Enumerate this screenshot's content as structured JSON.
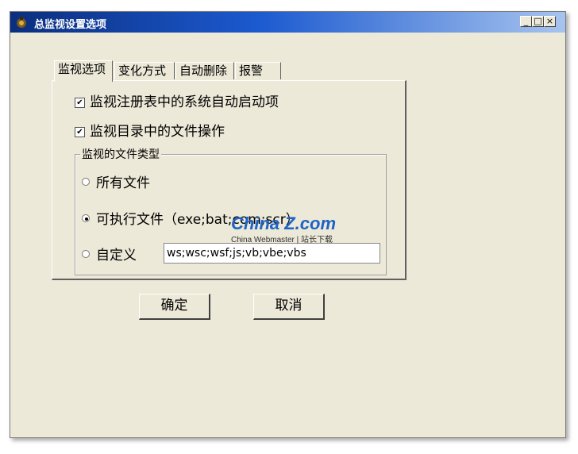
{
  "window": {
    "title": "总监视设置选项",
    "buttons": {
      "minimize": "_",
      "maximize": "□",
      "close": "×"
    }
  },
  "tabs": [
    {
      "label": "监视选项",
      "active": true
    },
    {
      "label": "变化方式",
      "active": false
    },
    {
      "label": "自动删除",
      "active": false
    },
    {
      "label": "报警",
      "active": false
    }
  ],
  "options": {
    "registry": {
      "label": "监视注册表中的系统自动启动项",
      "checked": true
    },
    "directory": {
      "label": "监视目录中的文件操作",
      "checked": true
    }
  },
  "file_types": {
    "group_label": "监视的文件类型",
    "all_files": {
      "label": "所有文件",
      "selected": false
    },
    "executables": {
      "label": "可执行文件（exe;bat;com;scr）",
      "selected": true
    },
    "custom": {
      "label": "自定义",
      "selected": false,
      "value": "ws;wsc;wsf;js;vb;vbe;vbs"
    }
  },
  "actions": {
    "ok_label": "确定",
    "cancel_label": "取消"
  },
  "watermark": {
    "brand": "China Z.com",
    "subtitle": "China Webmaster | 站长下载"
  },
  "colors": {
    "window_bg": "#ece9d8",
    "titlebar_start": "#0b2e7e",
    "titlebar_end": "#a7c4ee"
  }
}
